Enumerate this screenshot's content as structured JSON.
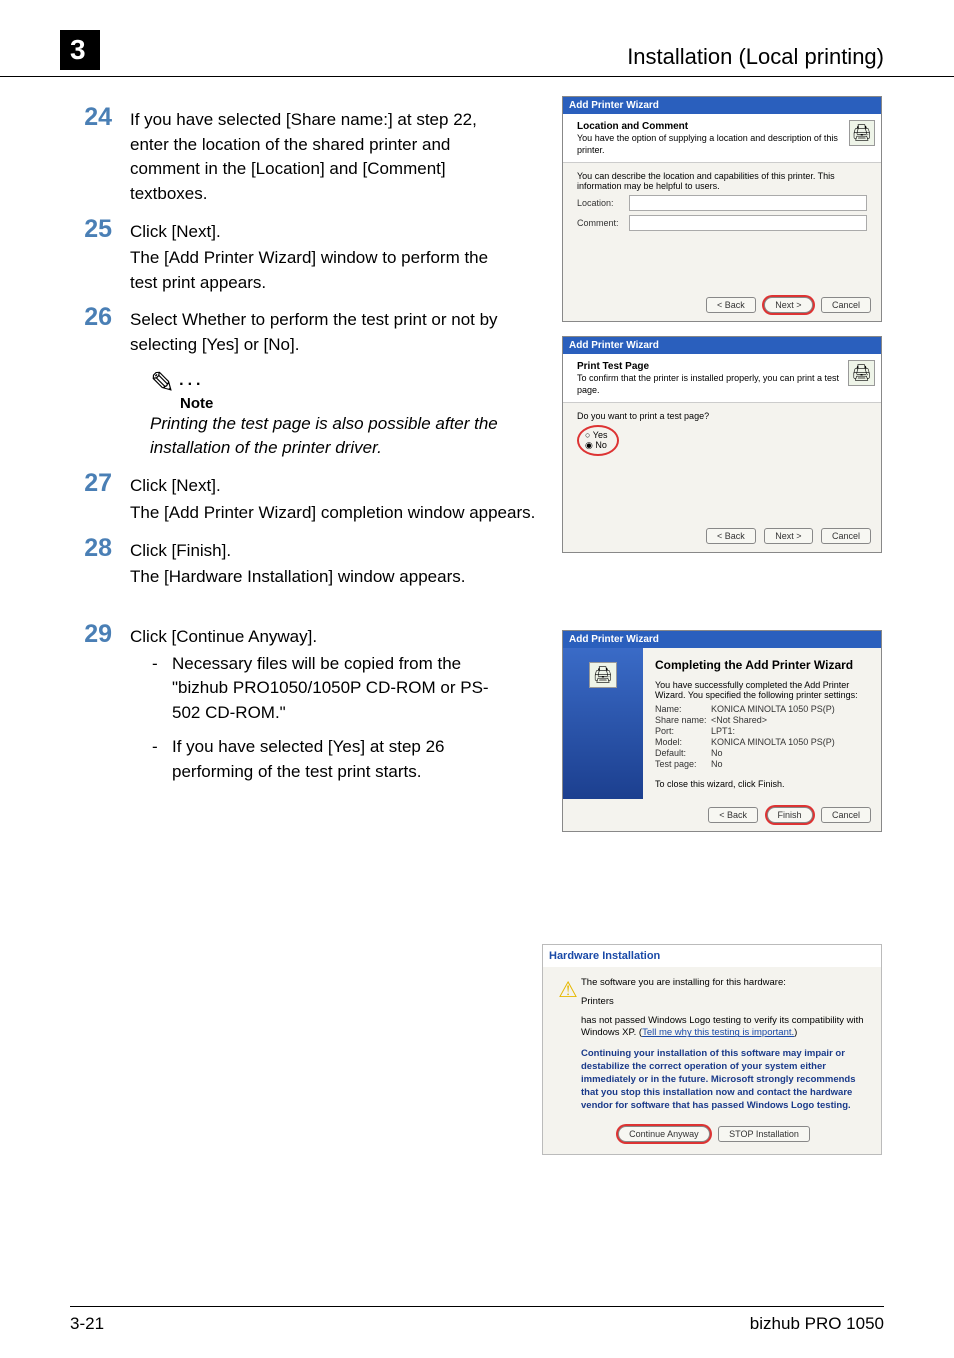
{
  "header": {
    "chapter_num": "3",
    "title": "Installation (Local printing)"
  },
  "footer": {
    "page": "3-21",
    "product": "bizhub PRO 1050"
  },
  "steps": {
    "s24": {
      "num": "24",
      "text": "If you have selected [Share name:] at step 22, enter the location of the shared printer and comment in the [Location] and [Comment] textboxes."
    },
    "s25": {
      "num": "25",
      "t1": "Click [Next].",
      "t2": "The [Add Printer Wizard] window to perform the test print appears."
    },
    "s26": {
      "num": "26",
      "text": "Select Whether to perform the test print or not by selecting [Yes] or [No]."
    },
    "s27": {
      "num": "27",
      "t1": "Click [Next].",
      "t2": "The [Add Printer Wizard] completion window appears."
    },
    "s28": {
      "num": "28",
      "t1": "Click [Finish].",
      "t2": "The [Hardware Installation] window appears."
    },
    "s29": {
      "num": "29",
      "t1": "Click [Continue Anyway].",
      "b1": "Necessary files will be copied from the \"bizhub PRO1050/1050P CD-ROM or PS-502 CD-ROM.\"",
      "b2": "If you have selected [Yes] at step 26 performing of the test print starts."
    }
  },
  "note": {
    "label": "Note",
    "text": "Printing the test page is also possible after the installation of the printer driver."
  },
  "dlg1": {
    "title": "Add Printer Wizard",
    "head_bold": "Location and Comment",
    "head_sub": "You have the option of supplying a location and description of this printer.",
    "body_intro": "You can describe the location and capabilities of this printer. This information may be helpful to users.",
    "loc_label": "Location:",
    "com_label": "Comment:",
    "back": "< Back",
    "next": "Next >",
    "cancel": "Cancel"
  },
  "dlg2": {
    "title": "Add Printer Wizard",
    "head_bold": "Print Test Page",
    "head_sub": "To confirm that the printer is installed properly, you can print a test page.",
    "question": "Do you want to print a test page?",
    "yes": "Yes",
    "no": "No",
    "back": "< Back",
    "next": "Next >",
    "cancel": "Cancel"
  },
  "dlg3": {
    "title": "Add Printer Wizard",
    "heading": "Completing the Add Printer Wizard",
    "desc": "You have successfully completed the Add Printer Wizard. You specified the following printer settings:",
    "rows": {
      "name_k": "Name:",
      "name_v": "KONICA MINOLTA 1050 PS(P)",
      "sn_k": "Share name:",
      "sn_v": "<Not Shared>",
      "port_k": "Port:",
      "port_v": "LPT1:",
      "model_k": "Model:",
      "model_v": "KONICA MINOLTA 1050 PS(P)",
      "def_k": "Default:",
      "def_v": "No",
      "tp_k": "Test page:",
      "tp_v": "No"
    },
    "close_text": "To close this wizard, click Finish.",
    "back": "< Back",
    "finish": "Finish",
    "cancel": "Cancel"
  },
  "dlg4": {
    "title": "Hardware Installation",
    "l1": "The software you are installing for this hardware:",
    "l2": "Printers",
    "l3a": "has not passed Windows Logo testing to verify its compatibility with Windows XP. (",
    "l3link": "Tell me why this testing is important.",
    "l3b": ")",
    "warn": "Continuing your installation of this software may impair or destabilize the correct operation of your system either immediately or in the future. Microsoft strongly recommends that you stop this installation now and contact the hardware vendor for software that has passed Windows Logo testing.",
    "cont": "Continue Anyway",
    "stop": "STOP Installation"
  }
}
